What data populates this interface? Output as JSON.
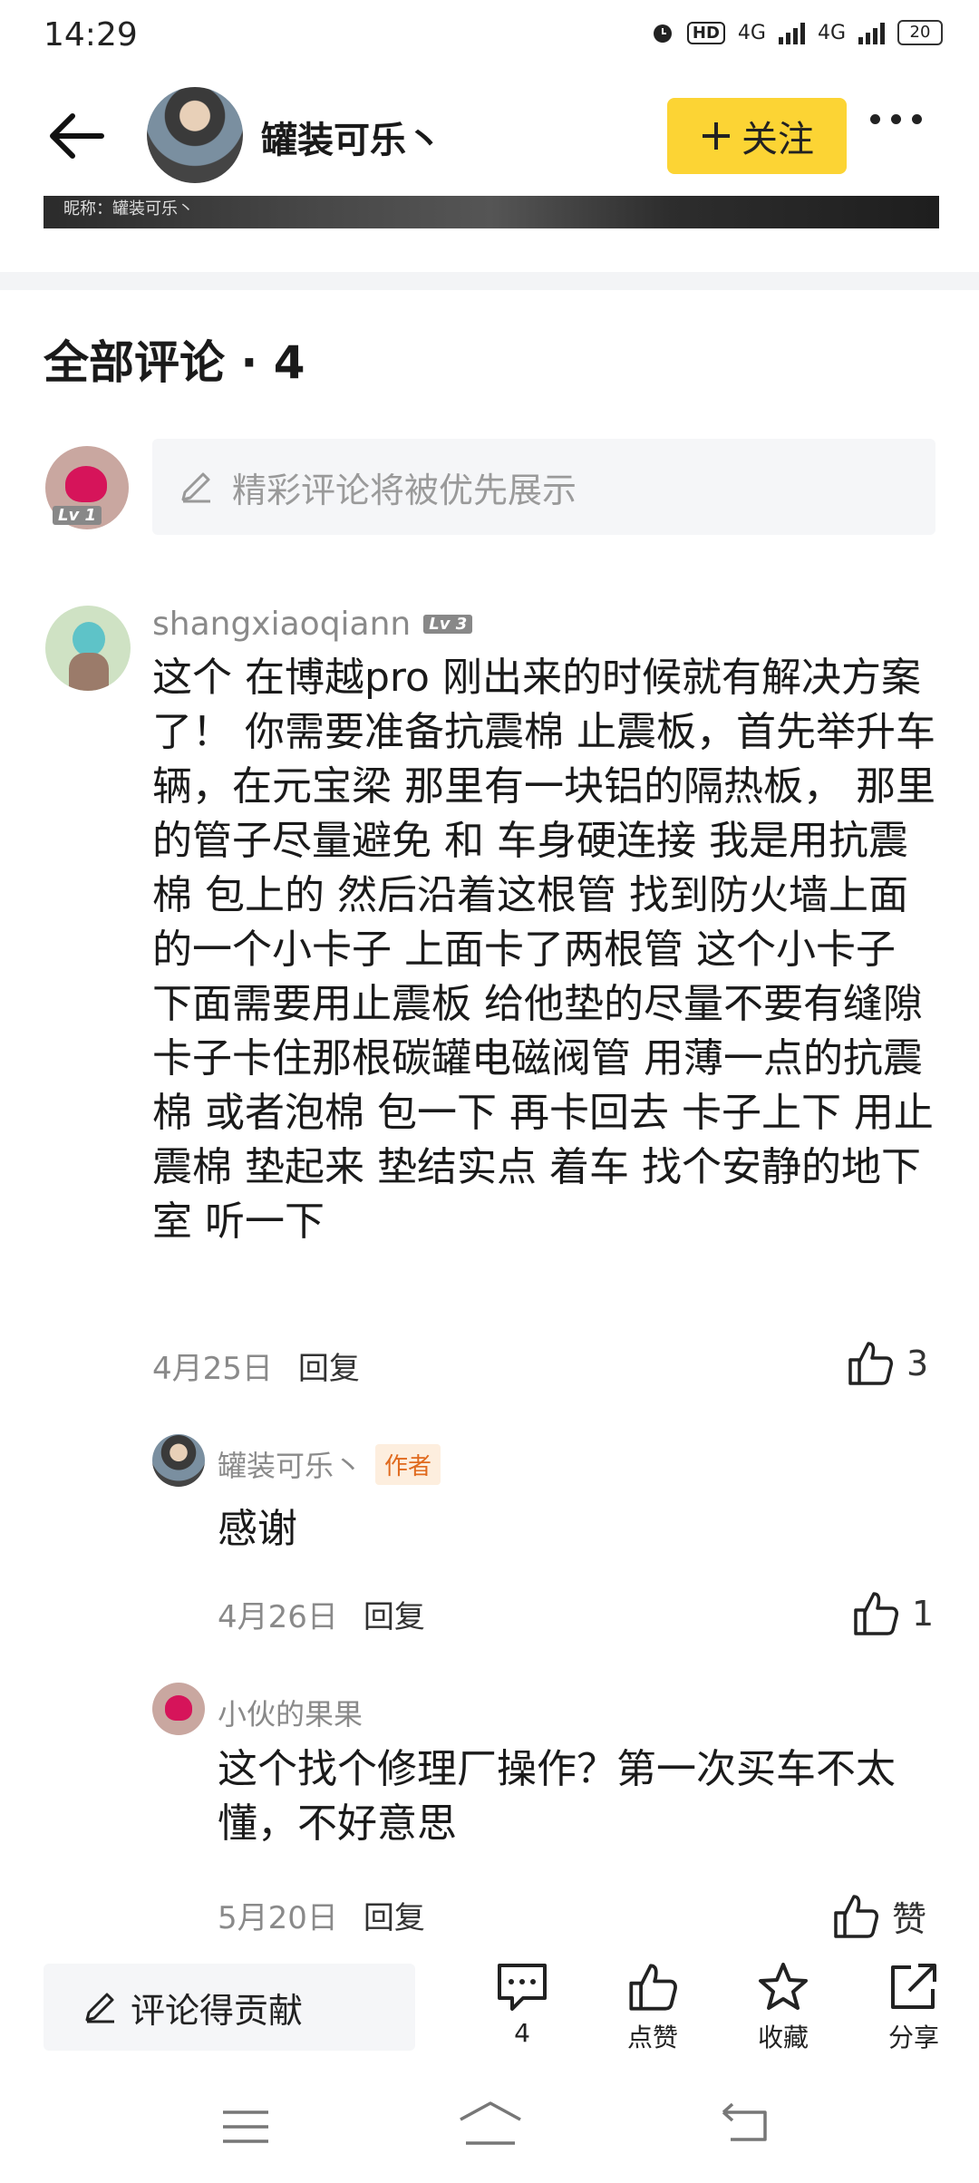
{
  "status_bar": {
    "time": "14:29",
    "hd": "HD",
    "sim1": "4G",
    "sim2": "4G",
    "battery": "20"
  },
  "header": {
    "author_name": "罐装可乐丶",
    "follow_label": "关注",
    "image_caption": "昵称：罐装可乐丶"
  },
  "comments": {
    "title": "全部评论 · 4",
    "me_level": "Lv 1",
    "input_placeholder": "精彩评论将被优先展示",
    "items": [
      {
        "user": "shangxiaoqiann",
        "level": "Lv 3",
        "text": "这个 在博越pro 刚出来的时候就有解决方案了！ 你需要准备抗震棉 止震板，首先举升车辆，在元宝梁 那里有一块铝的隔热板， 那里的管子尽量避免 和 车身硬连接 我是用抗震棉 包上的 然后沿着这根管 找到防火墙上面的一个小卡子 上面卡了两根管 这个小卡子 下面需要用止震板 给他垫的尽量不要有缝隙 卡子卡住那根碳罐电磁阀管 用薄一点的抗震棉 或者泡棉 包一下 再卡回去 卡子上下 用止震棉 垫起来 垫结实点 着车 找个安静的地下室 听一下",
        "date": "4月25日",
        "reply_label": "回复",
        "likes": "3"
      }
    ],
    "replies": [
      {
        "user": "罐装可乐丶",
        "tag": "作者",
        "text": "感谢",
        "date": "4月26日",
        "reply_label": "回复",
        "likes": "1"
      },
      {
        "user": "小伙的果果",
        "text": "这个找个修理厂操作？第一次买车不太懂，不好意思",
        "date": "5月20日",
        "reply_label": "回复",
        "likes": "赞"
      }
    ]
  },
  "bottom_bar": {
    "input_label": "评论得贡献",
    "comment_count": "4",
    "like_label": "点赞",
    "favorite_label": "收藏",
    "share_label": "分享"
  }
}
